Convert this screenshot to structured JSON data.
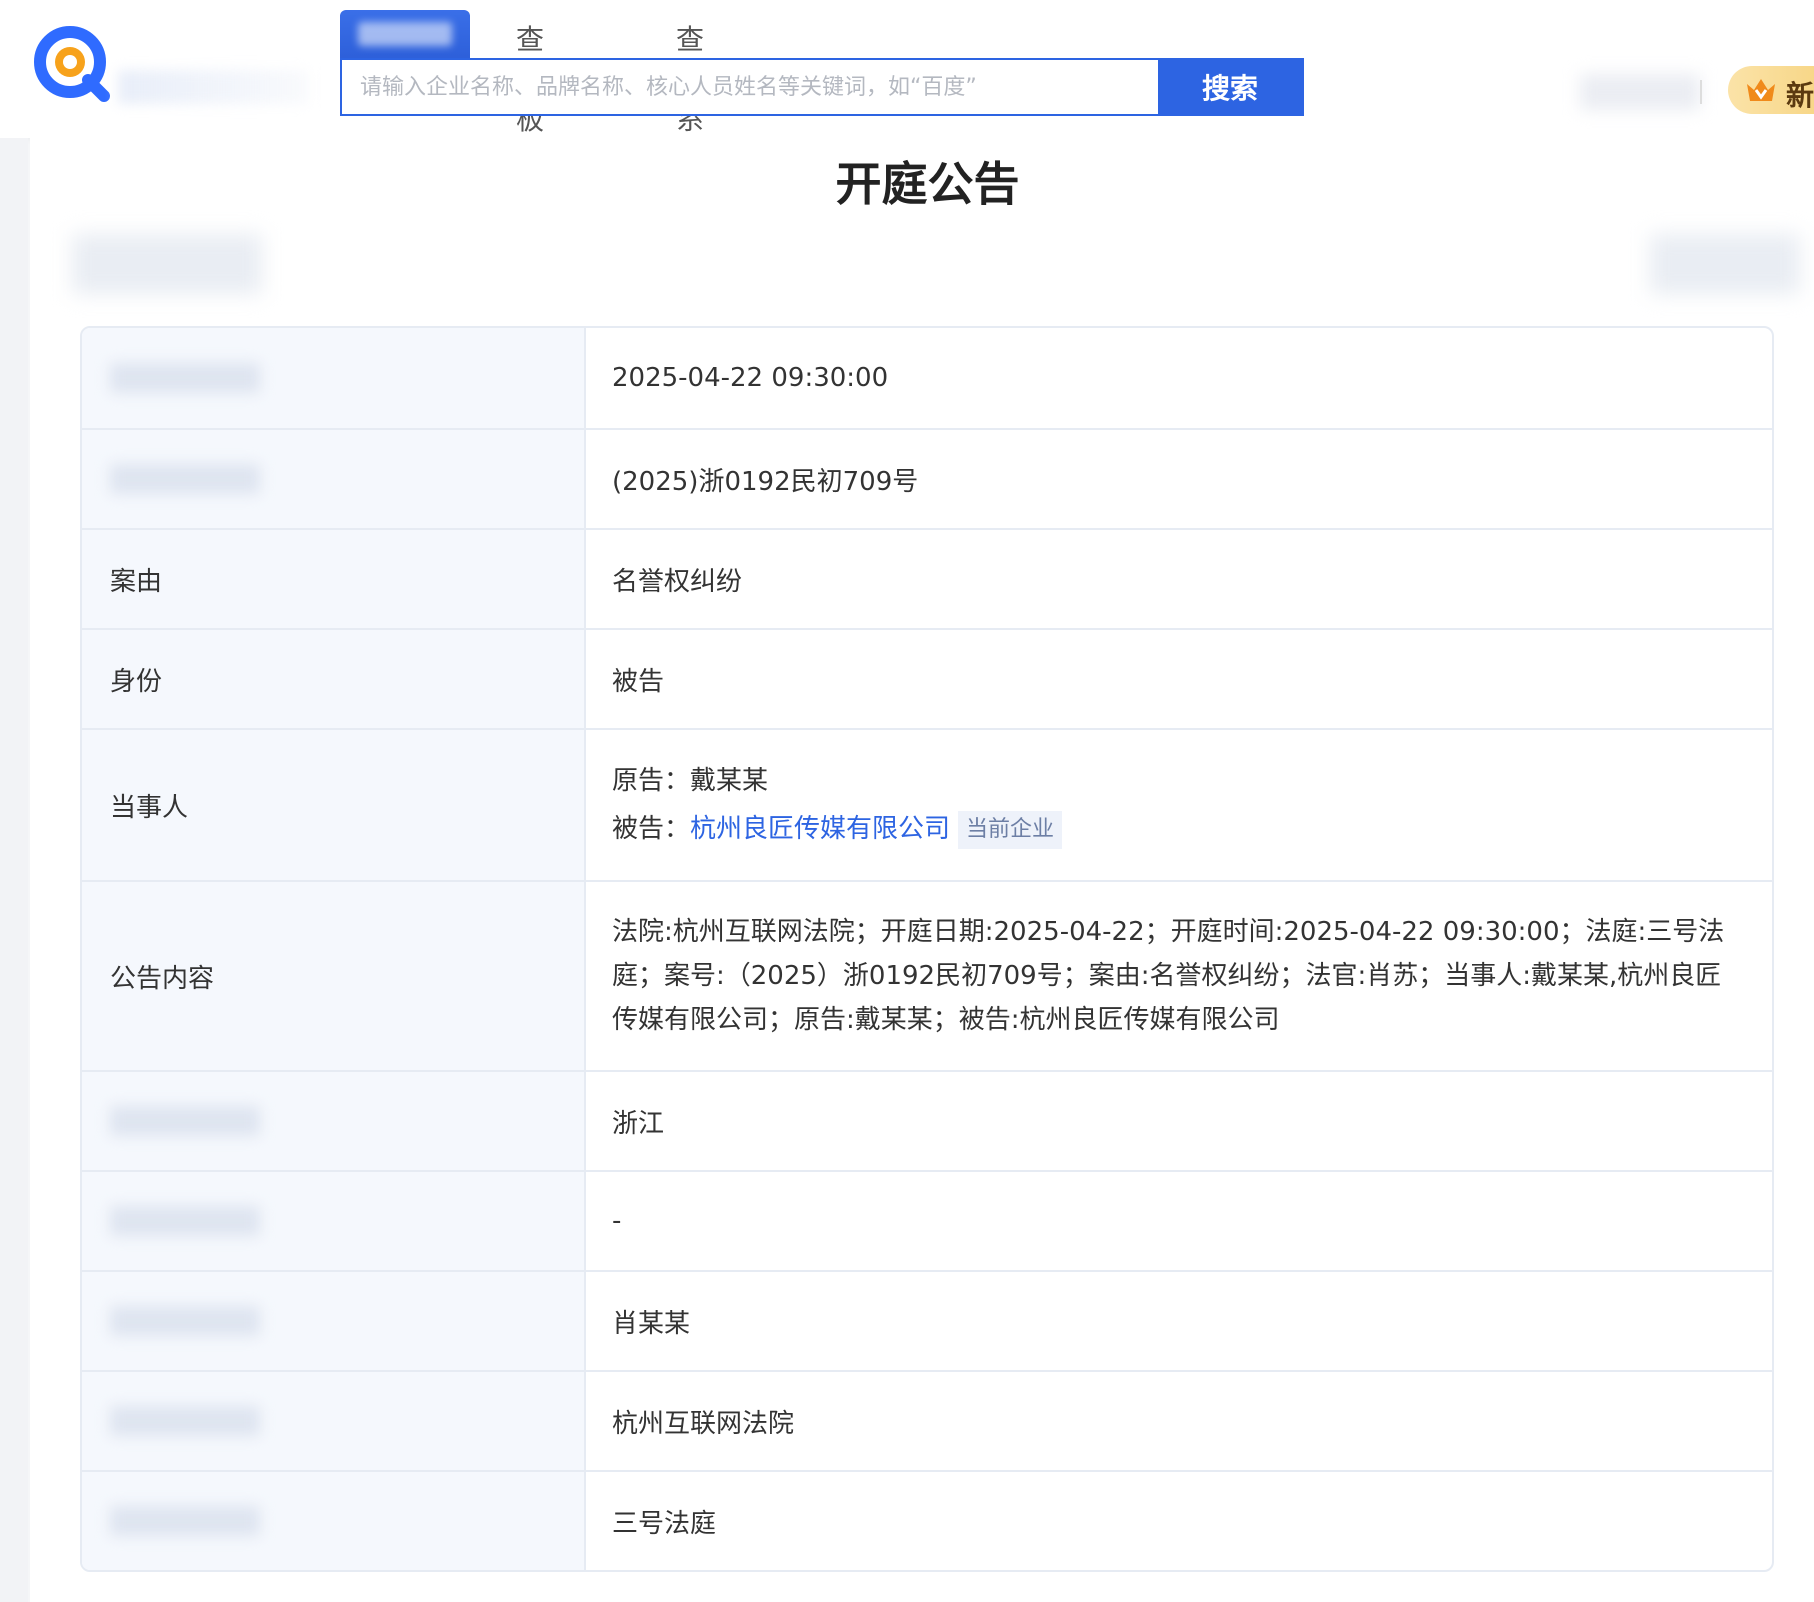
{
  "header": {
    "tabs": [
      {
        "label": "查老板"
      },
      {
        "label": "查关系"
      }
    ],
    "search": {
      "placeholder": "请输入企业名称、品牌名称、核心人员姓名等关键词，如“百度”",
      "button_label": "搜索"
    },
    "vip_label": "新"
  },
  "page": {
    "title": "开庭公告"
  },
  "table": {
    "rows": [
      {
        "label": "",
        "value": "2025-04-22 09:30:00"
      },
      {
        "label": "",
        "value": "(2025)浙0192民初709号"
      },
      {
        "label": "案由",
        "value": "名誉权纠纷"
      },
      {
        "label": "身份",
        "value": "被告"
      },
      {
        "label": "当事人",
        "plaintiff_prefix": "原告：",
        "plaintiff": "戴某某",
        "defendant_prefix": "被告：",
        "defendant": "杭州良匠传媒有限公司",
        "defendant_badge": "当前企业"
      },
      {
        "label": "公告内容",
        "value": "法院:杭州互联网法院；开庭日期:2025-04-22；开庭时间:2025-04-22 09:30:00；法庭:三号法庭；案号:（2025）浙0192民初709号；案由:名誉权纠纷；法官:肖苏；当事人:戴某某,杭州良匠传媒有限公司；原告:戴某某；被告:杭州良匠传媒有限公司"
      },
      {
        "label": "",
        "value": "浙江"
      },
      {
        "label": "",
        "value": "-"
      },
      {
        "label": "",
        "value": "肖某某"
      },
      {
        "label": "",
        "value": "杭州互联网法院"
      },
      {
        "label": "",
        "value": "三号法庭"
      }
    ]
  },
  "colors": {
    "accent": "#2d64e2",
    "label_bg": "#f5f8fd",
    "border": "#e6ebf3",
    "vip_gold": "#f6d27c"
  }
}
